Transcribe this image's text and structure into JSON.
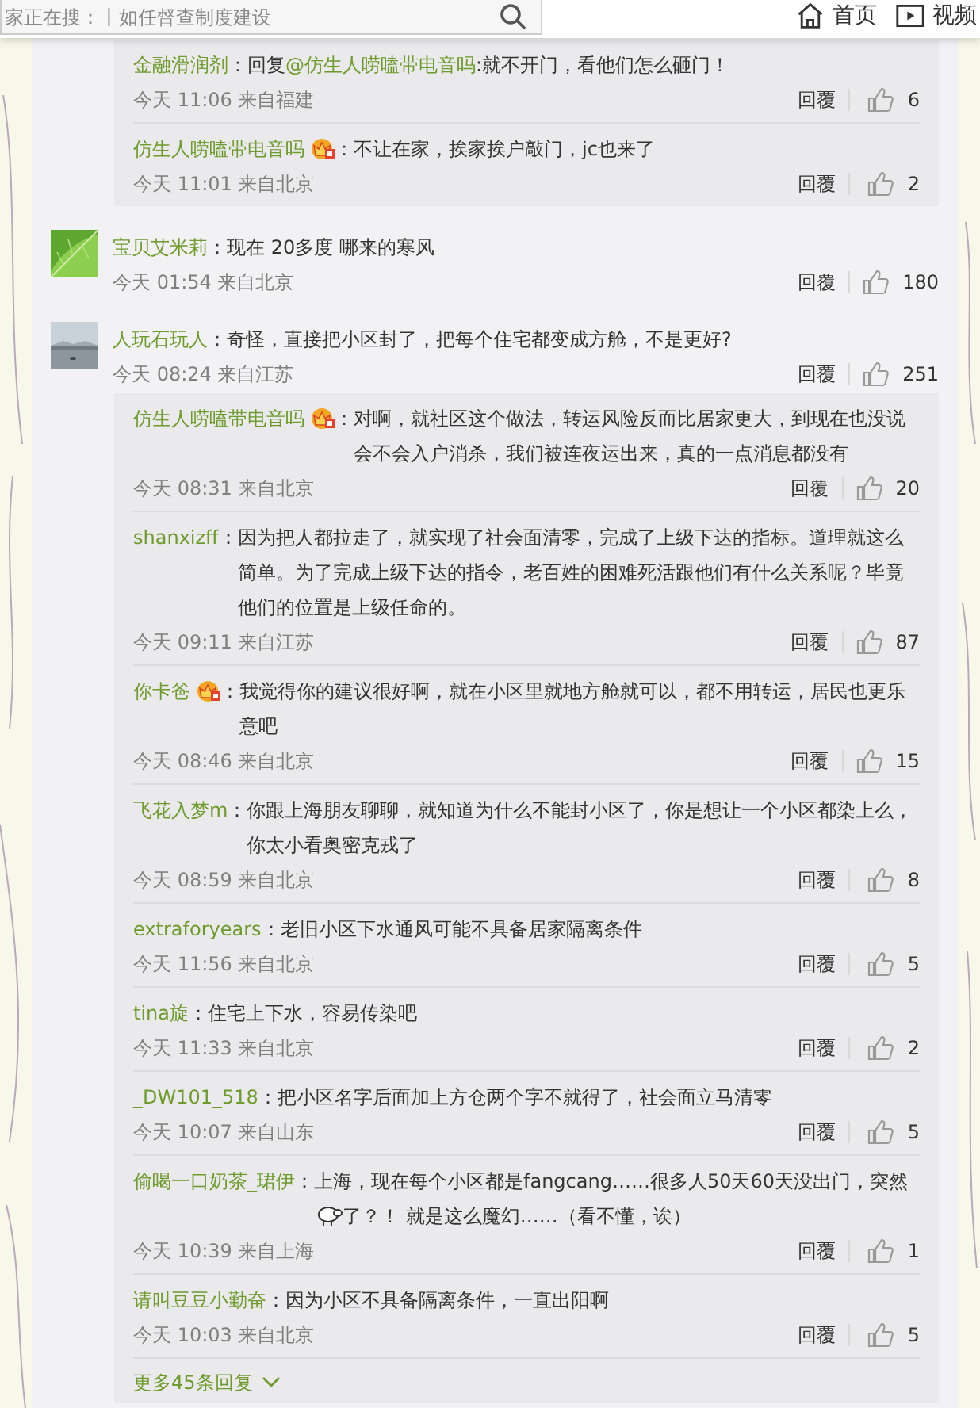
{
  "header": {
    "search": {
      "placeholder": "家正在搜：丨如任督查制度建设"
    },
    "nav": [
      {
        "label": "首页"
      },
      {
        "label": "视频"
      }
    ]
  },
  "leading_replies": [
    {
      "user": "金融滑润剂",
      "badge": false,
      "separator": "：",
      "prefix": "回复",
      "mention": "@仿生人唠嗑带电音吗",
      "text": ":就不开门，看他们怎么砸门！",
      "time": "今天 11:06 来自福建",
      "reply_label": "回覆",
      "likes": "6"
    },
    {
      "user": "仿生人唠嗑带电音吗",
      "badge": true,
      "separator": "：",
      "text": "不让在家，挨家挨户敲门，jc也来了",
      "time": "今天 11:01 来自北京",
      "reply_label": "回覆",
      "likes": "2"
    }
  ],
  "comments": [
    {
      "user": "宝贝艾米莉",
      "separator": "：",
      "text": "现在 20多度 哪来的寒风",
      "time": "今天 01:54 来自北京",
      "reply_label": "回覆",
      "likes": "180"
    },
    {
      "user": "人玩石玩人",
      "separator": "：",
      "text": "奇怪，直接把小区封了，把每个住宅都变成方舱，不是更好?",
      "time": "今天 08:24 来自江苏",
      "reply_label": "回覆",
      "likes": "251",
      "replies": [
        {
          "user": "仿生人唠嗑带电音吗",
          "badge": true,
          "separator": "：",
          "text": "对啊，就社区这个做法，转运风险反而比居家更大，到现在也没说会不会入户消杀，我们被连夜运出来，真的一点消息都没有",
          "time": "今天 08:31 来自北京",
          "reply_label": "回覆",
          "likes": "20"
        },
        {
          "user": "shanxizff",
          "badge": false,
          "separator": "：",
          "text": "因为把人都拉走了，就实现了社会面清零，完成了上级下达的指标。道理就这么简单。为了完成上级下达的指令，老百姓的困难死活跟他们有什么关系呢？毕竟他们的位置是上级任命的。",
          "time": "今天 09:11 来自江苏",
          "reply_label": "回覆",
          "likes": "87"
        },
        {
          "user": "你卡爸",
          "badge": true,
          "separator": "：",
          "text": "我觉得你的建议很好啊，就在小区里就地方舱就可以，都不用转运，居民也更乐意吧",
          "time": "今天 08:46 来自北京",
          "reply_label": "回覆",
          "likes": "15"
        },
        {
          "user": "飞花入梦m",
          "badge": false,
          "separator": "：",
          "text": "你跟上海朋友聊聊，就知道为什么不能封小区了，你是想让一个小区都染上么，你太小看奥密克戎了",
          "time": "今天 08:59 来自北京",
          "reply_label": "回覆",
          "likes": "8"
        },
        {
          "user": "extraforyears",
          "badge": false,
          "separator": "：",
          "text": "老旧小区下水通风可能不具备居家隔离条件",
          "time": "今天 11:56 来自北京",
          "reply_label": "回覆",
          "likes": "5"
        },
        {
          "user": "tina旋",
          "badge": false,
          "separator": "：",
          "text": "住宅上下水，容易传染吧",
          "time": "今天 11:33 来自北京",
          "reply_label": "回覆",
          "likes": "2"
        },
        {
          "user": "_DW101_518",
          "badge": false,
          "separator": "：",
          "text": "把小区名字后面加上方仓两个字不就得了，社会面立马清零",
          "time": "今天 10:07 来自山东",
          "reply_label": "回覆",
          "likes": "5"
        },
        {
          "user": "偷喝一口奶茶_珺伊",
          "badge": false,
          "separator": "：",
          "parts": [
            {
              "kind": "text",
              "text": "上海，现在每个小区都是fangcang……很多人50天60天没出门，突然"
            },
            {
              "kind": "emoji"
            },
            {
              "kind": "text",
              "text": "了？！ 就是这么魔幻……（看不懂，诶）"
            }
          ],
          "time": "今天 10:39 来自上海",
          "reply_label": "回覆",
          "likes": "1"
        },
        {
          "user": "请叫豆豆小勤奋",
          "badge": false,
          "separator": "：",
          "text": "因为小区不具备隔离条件，一直出阳啊",
          "time": "今天 10:03 来自北京",
          "reply_label": "回覆",
          "likes": "5"
        }
      ],
      "more": "更多45条回复"
    }
  ]
}
